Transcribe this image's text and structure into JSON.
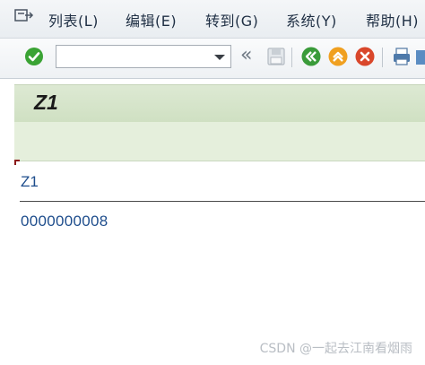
{
  "menu": {
    "items": [
      {
        "label": "列表(L)"
      },
      {
        "label": "编辑(E)"
      },
      {
        "label": "转到(G)"
      },
      {
        "label": "系统(Y)"
      },
      {
        "label": "帮助(H)"
      }
    ]
  },
  "toolbar": {
    "command_field_value": "",
    "icons": [
      "enter-icon",
      "command-dropdown-icon",
      "collapse-toolbar-icon",
      "save-icon",
      "back-icon",
      "exit-icon",
      "cancel-icon",
      "print-icon",
      "find-icon"
    ]
  },
  "screen": {
    "title": "Z1"
  },
  "list": {
    "column_header": "Z1",
    "values": [
      "0000000008"
    ]
  },
  "watermark": "CSDN @一起去江南看烟雨",
  "colors": {
    "title_bar": "#d5e4c9",
    "text_blue": "#1e4d8c",
    "enter_green": "#3aa334",
    "cancel_red": "#d9472b",
    "exit_orange": "#f0a020"
  }
}
